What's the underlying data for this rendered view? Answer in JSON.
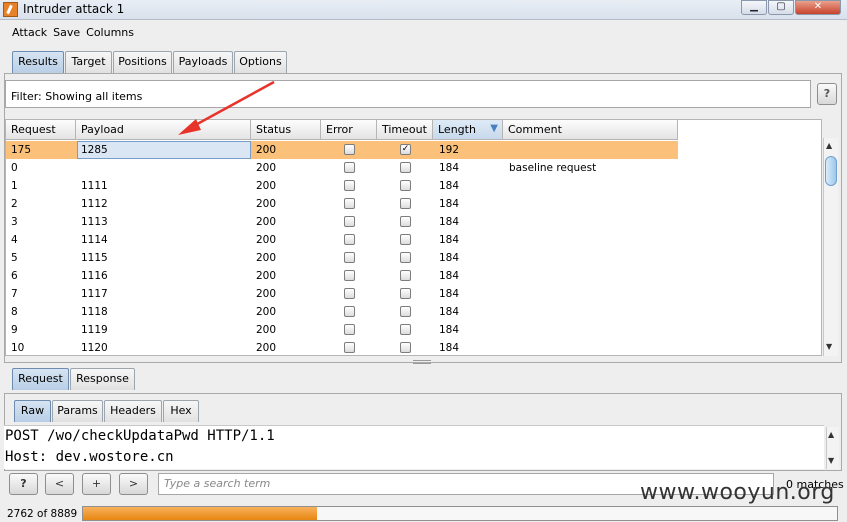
{
  "window": {
    "title": "Intruder attack 1"
  },
  "menu": [
    "Attack",
    "Save",
    "Columns"
  ],
  "main_tabs": [
    "Results",
    "Target",
    "Positions",
    "Payloads",
    "Options"
  ],
  "filter": {
    "text": "Filter:  Showing all items",
    "help": "?"
  },
  "table": {
    "columns": [
      "Request",
      "Payload",
      "Status",
      "Error",
      "Timeout",
      "Length",
      "Comment"
    ],
    "sort_column": "Length",
    "rows": [
      {
        "request": "175",
        "payload": "1285",
        "status": "200",
        "error": false,
        "timeout": true,
        "length": "192",
        "comment": "",
        "selected": true
      },
      {
        "request": "0",
        "payload": "",
        "status": "200",
        "error": false,
        "timeout": false,
        "length": "184",
        "comment": "baseline request"
      },
      {
        "request": "1",
        "payload": "1111",
        "status": "200",
        "error": false,
        "timeout": false,
        "length": "184",
        "comment": ""
      },
      {
        "request": "2",
        "payload": "1112",
        "status": "200",
        "error": false,
        "timeout": false,
        "length": "184",
        "comment": ""
      },
      {
        "request": "3",
        "payload": "1113",
        "status": "200",
        "error": false,
        "timeout": false,
        "length": "184",
        "comment": ""
      },
      {
        "request": "4",
        "payload": "1114",
        "status": "200",
        "error": false,
        "timeout": false,
        "length": "184",
        "comment": ""
      },
      {
        "request": "5",
        "payload": "1115",
        "status": "200",
        "error": false,
        "timeout": false,
        "length": "184",
        "comment": ""
      },
      {
        "request": "6",
        "payload": "1116",
        "status": "200",
        "error": false,
        "timeout": false,
        "length": "184",
        "comment": ""
      },
      {
        "request": "7",
        "payload": "1117",
        "status": "200",
        "error": false,
        "timeout": false,
        "length": "184",
        "comment": ""
      },
      {
        "request": "8",
        "payload": "1118",
        "status": "200",
        "error": false,
        "timeout": false,
        "length": "184",
        "comment": ""
      },
      {
        "request": "9",
        "payload": "1119",
        "status": "200",
        "error": false,
        "timeout": false,
        "length": "184",
        "comment": ""
      },
      {
        "request": "10",
        "payload": "1120",
        "status": "200",
        "error": false,
        "timeout": false,
        "length": "184",
        "comment": ""
      }
    ]
  },
  "detail_tabs": [
    "Request",
    "Response"
  ],
  "view_tabs": [
    "Raw",
    "Params",
    "Headers",
    "Hex"
  ],
  "raw_lines": [
    "POST /wo/checkUpdataPwd HTTP/1.1",
    "Host: dev.wostore.cn"
  ],
  "search": {
    "placeholder": "Type a search term",
    "matches": "0 matches",
    "buttons": [
      "?",
      "<",
      "+",
      ">"
    ]
  },
  "progress": {
    "text": "2762 of 8889",
    "done": 2762,
    "total": 8889
  },
  "watermark": "www.wooyun.org",
  "colors": {
    "selected_row": "#fbc07a",
    "progress_fill": "#f0a030",
    "annotation_arrow": "#e8332a",
    "tab_selected": "#c4d6ea"
  }
}
